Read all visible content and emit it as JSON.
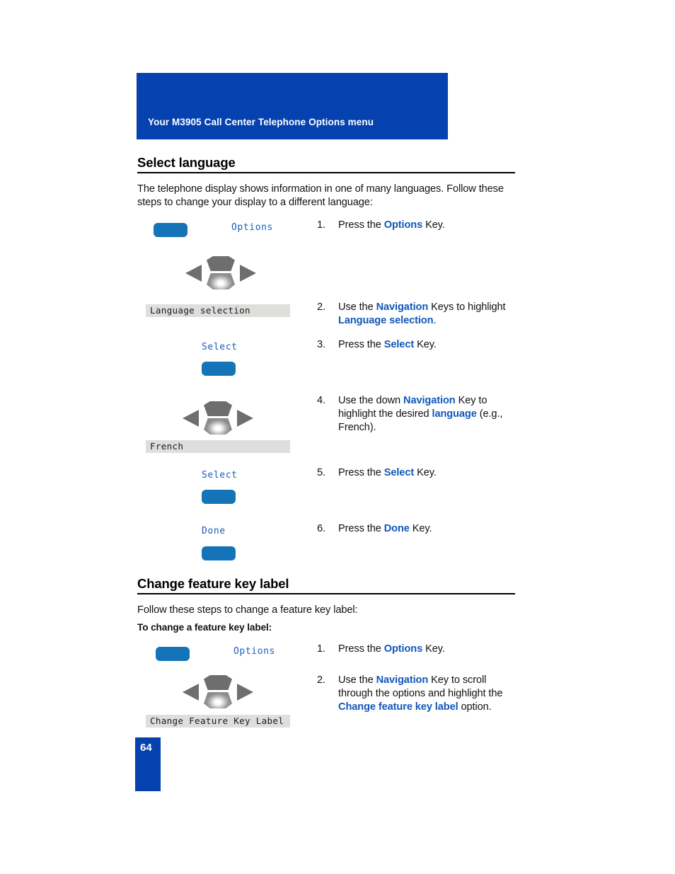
{
  "header": {
    "title": "Your M3905 Call Center Telephone Options menu"
  },
  "page_number": "64",
  "sections": [
    {
      "id": "select-language",
      "heading": "Select language",
      "intro": "The telephone display shows information in one of many languages. Follow these steps to change your display to a different language:",
      "steps": [
        {
          "num": "1.",
          "html": "Press the <b class=\"blue\">Options</b> Key."
        },
        {
          "num": "2.",
          "html": "Use the <b class=\"blue\">Navigation</b> Keys to highlight <b class=\"blue\">Language selection</b>."
        },
        {
          "num": "3.",
          "html": "Press the <b class=\"blue\">Select</b> Key."
        },
        {
          "num": "4.",
          "html": "Use the down <b class=\"blue\">Navigation</b> Key to highlight the desired <b class=\"blue\">language</b> (e.g., French)."
        },
        {
          "num": "5.",
          "html": "Press the <b class=\"blue\">Select</b> Key."
        },
        {
          "num": "6.",
          "html": "Press the <b class=\"blue\">Done</b> Key."
        }
      ],
      "graphics": {
        "softkey_label_options": "Options",
        "softkey_label_select_1": "Select",
        "softkey_label_select_2": "Select",
        "softkey_label_done": "Done",
        "display_language_selection": "Language selection",
        "display_french": "French"
      }
    },
    {
      "id": "change-feature-key-label",
      "heading": "Change feature key label",
      "intro": "Follow these steps to change a feature key label:",
      "subintro": "To change a feature key label:",
      "steps": [
        {
          "num": "1.",
          "html": "Press the <b class=\"blue\">Options</b> Key."
        },
        {
          "num": "2.",
          "html": "Use the <b class=\"blue\">Navigation</b> Key to scroll through the options and highlight the <b class=\"blue\">Change feature key label</b> option."
        }
      ],
      "graphics": {
        "softkey_label_options": "Options",
        "display_change_feature_key_label": "Change Feature Key Label"
      }
    }
  ],
  "colors": {
    "brand_blue": "#0542b0",
    "softkey_blue": "#1574b8",
    "link_blue": "#1158ba",
    "lcd_bar_gray": "#dededd",
    "nav_key_gray": "#6e6e6e"
  }
}
